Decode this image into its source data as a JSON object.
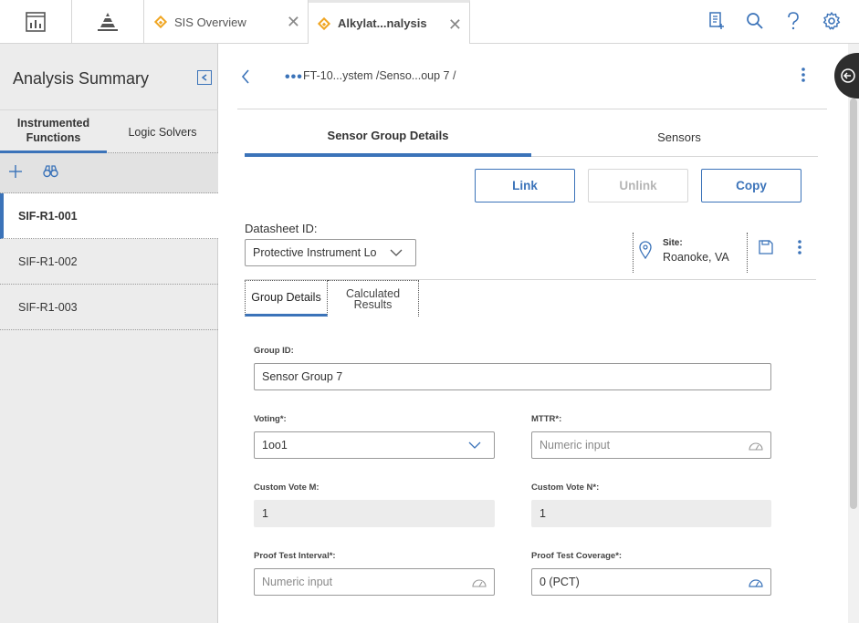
{
  "topbar": {
    "home_icon": "dashboard-icon",
    "pyramid_icon": "pyramid-icon",
    "tabs": [
      {
        "label": "SIS Overview",
        "icon": "diamond-icon",
        "active": false
      },
      {
        "label": "Alkylat...nalysis",
        "icon": "diamond-icon",
        "active": true
      }
    ],
    "right_icons": [
      "add-note-icon",
      "search-icon",
      "help-icon",
      "gear-icon"
    ]
  },
  "left_panel": {
    "title": "Analysis Summary",
    "tabs": [
      {
        "label": "Instrumented Functions",
        "active": true
      },
      {
        "label": "Logic Solvers",
        "active": false
      }
    ],
    "toolbar": [
      "plus-icon",
      "binoculars-icon"
    ],
    "items": [
      {
        "label": "SIF-R1-001",
        "selected": true
      },
      {
        "label": "SIF-R1-002",
        "selected": false
      },
      {
        "label": "SIF-R1-003",
        "selected": false
      }
    ]
  },
  "header": {
    "breadcrumb": "FT-10...ystem /Senso...oup 7 /",
    "dots": "•••"
  },
  "main_tabs": [
    {
      "label": "Sensor Group Details",
      "active": true
    },
    {
      "label": "Sensors",
      "active": false
    }
  ],
  "actions": {
    "link": "Link",
    "unlink": "Unlink",
    "copy": "Copy"
  },
  "datasheet": {
    "label": "Datasheet ID:",
    "value": "Protective Instrument Lo"
  },
  "site": {
    "label": "Site:",
    "value": "Roanoke, VA"
  },
  "sub_tabs": [
    {
      "label": "Group Details",
      "active": true
    },
    {
      "label": "Calculated Results",
      "active": false
    }
  ],
  "form": {
    "group_id": {
      "label": "Group ID:",
      "value": "Sensor Group 7"
    },
    "voting": {
      "label": "Voting*:",
      "value": "1oo1"
    },
    "mttr": {
      "label": "MTTR*:",
      "placeholder": "Numeric input"
    },
    "custom_vote_m": {
      "label": "Custom Vote M:",
      "value": "1"
    },
    "custom_vote_n": {
      "label": "Custom Vote N*:",
      "value": "1"
    },
    "proof_test_interval": {
      "label": "Proof Test Interval*:",
      "placeholder": "Numeric input"
    },
    "proof_test_coverage": {
      "label": "Proof Test Coverage*:",
      "value": "0 (PCT)"
    }
  },
  "colors": {
    "accent": "#3b73b9",
    "tab_diamond": "#f0a623"
  }
}
